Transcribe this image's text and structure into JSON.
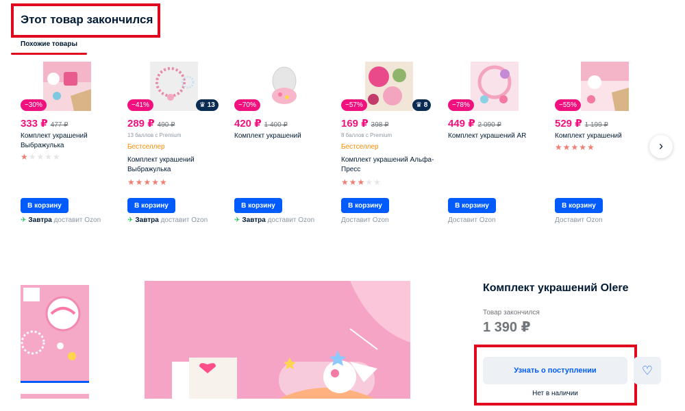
{
  "header": {
    "title": "Этот товар закончился",
    "tab": "Похожие товары"
  },
  "colors": {
    "accent": "#005bff",
    "discount": "#f1117e",
    "highlight": "#e0061d",
    "bestseller": "#ff8a00"
  },
  "cards": [
    {
      "discount": "−30%",
      "price": "333 ₽",
      "old_price": "477 ₽",
      "points": "",
      "bestseller": "",
      "name": "Комплект украшений Выбражулька",
      "rating": 1,
      "count": "",
      "button": "В корзину",
      "delivery_day": "Завтра",
      "delivery_text": "доставит Ozon"
    },
    {
      "discount": "−41%",
      "price": "289 ₽",
      "old_price": "490 ₽",
      "points": "13 баллов с Premium",
      "bestseller": "Бестселлер",
      "name": "Комплект украшений Выбражулька",
      "rating": 5,
      "count": "13",
      "button": "В корзину",
      "delivery_day": "Завтра",
      "delivery_text": "доставит Ozon"
    },
    {
      "discount": "−70%",
      "price": "420 ₽",
      "old_price": "1 400 ₽",
      "points": "",
      "bestseller": "",
      "name": "Комплект украшений",
      "rating": 0,
      "count": "",
      "button": "В корзину",
      "delivery_day": "Завтра",
      "delivery_text": "доставит Ozon"
    },
    {
      "discount": "−57%",
      "price": "169 ₽",
      "old_price": "398 ₽",
      "points": "8 баллов с Premium",
      "bestseller": "Бестселлер",
      "name": "Комплект украшений Альфа-Пресс",
      "rating": 3,
      "count": "8",
      "button": "В корзину",
      "delivery_day": "",
      "delivery_text": "Доставит Ozon"
    },
    {
      "discount": "−78%",
      "price": "449 ₽",
      "old_price": "2 090 ₽",
      "points": "",
      "bestseller": "",
      "name": "Комплект украшений AR",
      "rating": 0,
      "count": "",
      "button": "В корзину",
      "delivery_day": "",
      "delivery_text": "Доставит Ozon"
    },
    {
      "discount": "−55%",
      "price": "529 ₽",
      "old_price": "1 199 ₽",
      "points": "",
      "bestseller": "",
      "name": "Комплект украшений",
      "rating": 5,
      "count": "",
      "button": "В корзину",
      "delivery_day": "",
      "delivery_text": "Доставит Ozon"
    }
  ],
  "product": {
    "title": "Комплект украшений Olere",
    "status": "Товар закончился",
    "price": "1 390 ₽",
    "notify_button": "Узнать о поступлении",
    "availability": "Нет в наличии"
  },
  "icons": {
    "next": "chevron-right-icon",
    "favorite": "heart-icon",
    "delivery": "rocket-icon",
    "count": "crown-icon"
  }
}
